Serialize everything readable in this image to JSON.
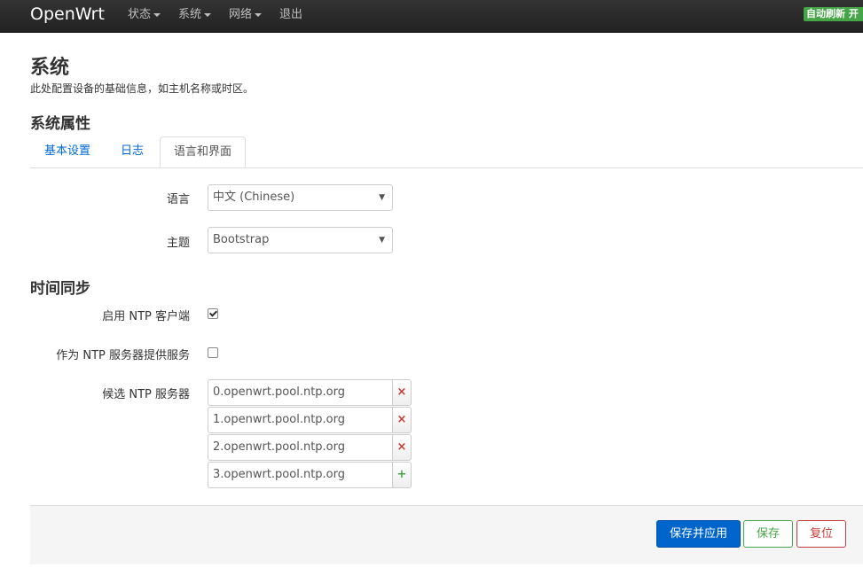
{
  "navbar": {
    "brand": "OpenWrt",
    "items": [
      {
        "label": "状态",
        "dropdown": true
      },
      {
        "label": "系统",
        "dropdown": true
      },
      {
        "label": "网络",
        "dropdown": true
      },
      {
        "label": "退出",
        "dropdown": false
      }
    ],
    "badge": "自动刷新 开"
  },
  "page": {
    "title": "系统",
    "description": "此处配置设备的基础信息，如主机名称或时区。"
  },
  "system_properties": {
    "heading": "系统属性",
    "tabs": [
      {
        "label": "基本设置",
        "active": false
      },
      {
        "label": "日志",
        "active": false
      },
      {
        "label": "语言和界面",
        "active": true
      }
    ],
    "language": {
      "label": "语言",
      "value": "中文 (Chinese)"
    },
    "theme": {
      "label": "主题",
      "value": "Bootstrap"
    }
  },
  "time_sync": {
    "heading": "时间同步",
    "enable_ntp_client": {
      "label": "启用 NTP 客户端",
      "checked": true
    },
    "ntp_server": {
      "label": "作为 NTP 服务器提供服务",
      "checked": false
    },
    "candidates": {
      "label": "候选 NTP 服务器",
      "servers": [
        {
          "value": "0.openwrt.pool.ntp.org",
          "button": "×"
        },
        {
          "value": "1.openwrt.pool.ntp.org",
          "button": "×"
        },
        {
          "value": "2.openwrt.pool.ntp.org",
          "button": "×"
        },
        {
          "value": "3.openwrt.pool.ntp.org",
          "button": "+"
        }
      ]
    }
  },
  "actions": {
    "save_apply": "保存并应用",
    "save": "保存",
    "reset": "复位"
  },
  "colors": {
    "primary": "#0064cd",
    "success": "#46a546",
    "danger": "#c43c35"
  }
}
